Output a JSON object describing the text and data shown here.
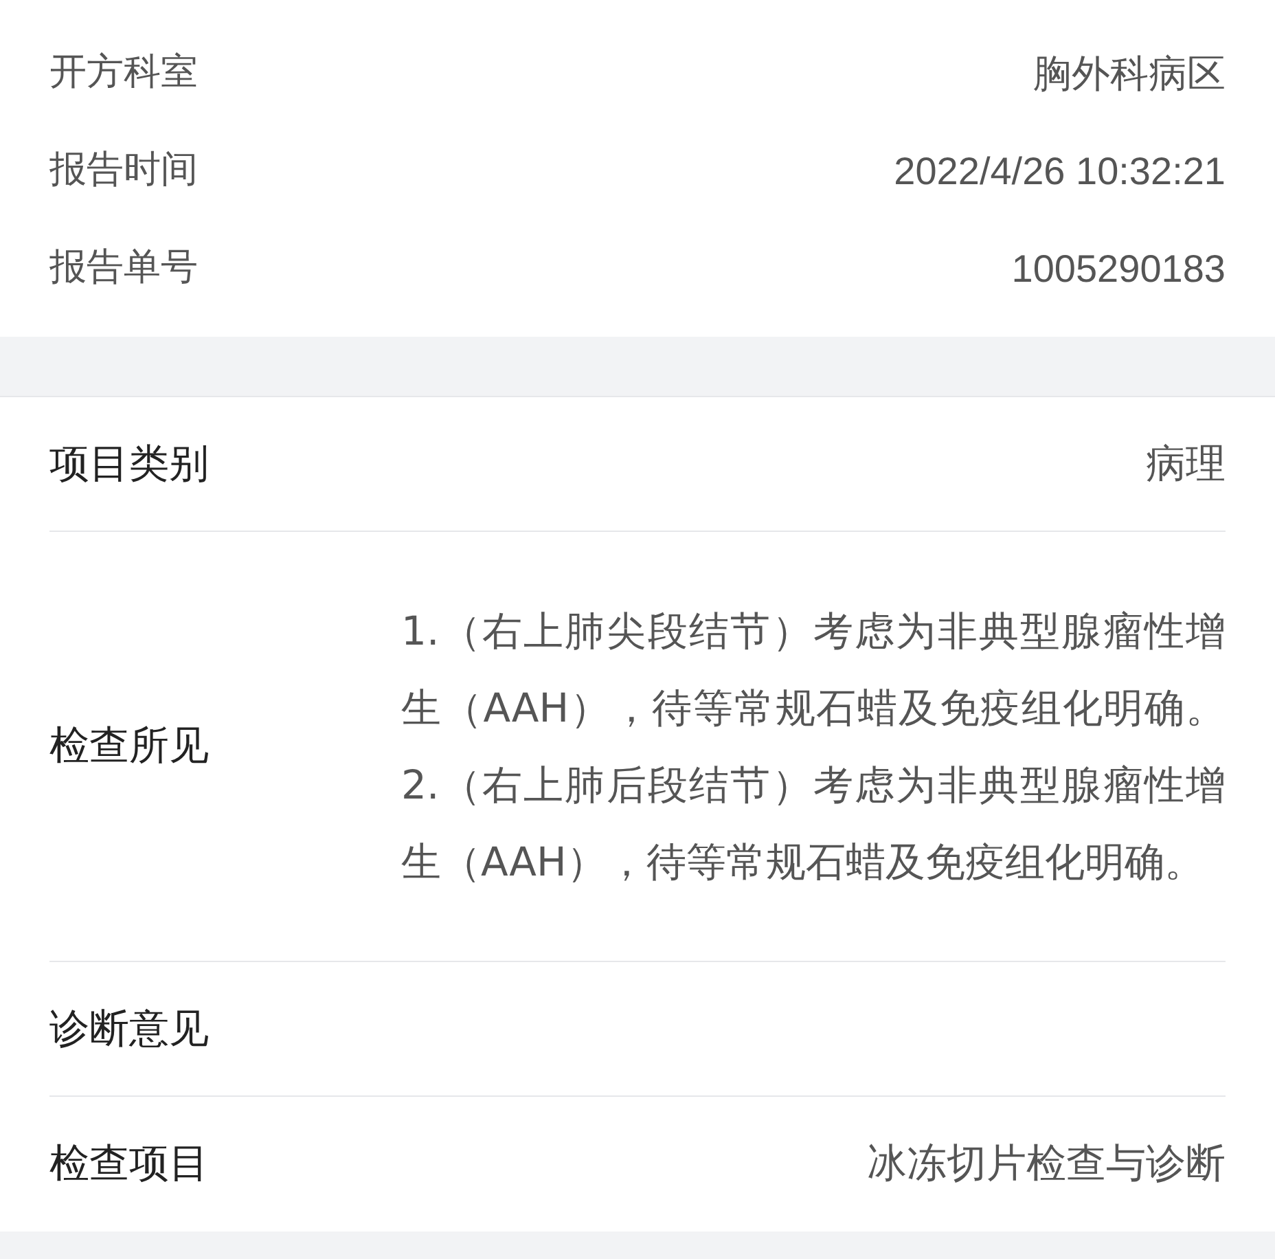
{
  "report_info": [
    {
      "label": "开方科室",
      "value": "胸外科病区"
    },
    {
      "label": "报告时间",
      "value": "2022/4/26 10:32:21"
    },
    {
      "label": "报告单号",
      "value": "1005290183"
    }
  ],
  "result_rows": [
    {
      "kind": "short",
      "label": "项目类别",
      "value": "病理"
    },
    {
      "kind": "long",
      "label": "检查所见",
      "value": "1.（右上肺尖段结节）考虑为非典型腺瘤性增生（AAH），待等常规石蜡及免疫组化明确。 2.（右上肺后段结节）考虑为非典型腺瘤性增生（AAH），待等常规石蜡及免疫组化明确。"
    },
    {
      "kind": "short",
      "label": "诊断意见"
    },
    {
      "kind": "short",
      "label": "检查项目",
      "value": "冰冻切片检查与诊断"
    }
  ]
}
